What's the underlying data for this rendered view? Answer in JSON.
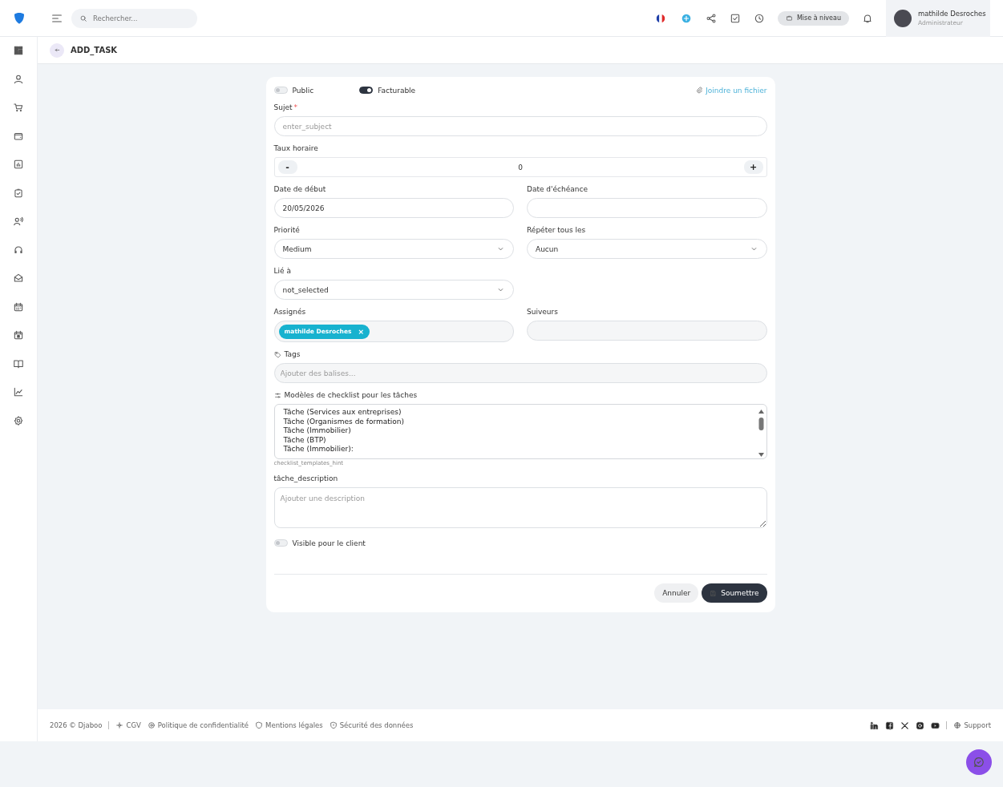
{
  "topbar": {
    "search": {
      "placeholder": "Rechercher..."
    },
    "upgrade_button": "Mise à niveau",
    "user": {
      "name": "mathilde Desroches",
      "role": "Administrateur"
    }
  },
  "page_header": {
    "title": "ADD_TASK"
  },
  "form": {
    "toggles": [
      {
        "label": "Public",
        "on": false
      },
      {
        "label": "Facturable",
        "on": true
      }
    ],
    "attach_link": "Joindre un fichier",
    "subject": {
      "label": "Sujet",
      "required_mark": "*",
      "placeholder": "enter_subject"
    },
    "hourly_rate": {
      "label": "Taux horaire",
      "value": "0",
      "minus": "-",
      "plus": "+"
    },
    "start_date": {
      "label": "Date de début",
      "value": "20/05/2026"
    },
    "due_date": {
      "label": "Date d'échéance"
    },
    "priority": {
      "label": "Priorité",
      "value": "Medium"
    },
    "repeat": {
      "label": "Répéter tous les",
      "value": "Aucun"
    },
    "related_to": {
      "label": "Lié à",
      "value": "not_selected"
    },
    "assignees": {
      "label": "Assignés",
      "chips": [
        {
          "name": "mathilde Desroches",
          "remove": "×"
        }
      ]
    },
    "followers": {
      "label": "Suiveurs"
    },
    "tags": {
      "label": "Tags",
      "placeholder": "Ajouter des balises..."
    },
    "checklist_templates": {
      "label": "Modèles de checklist pour les tâches",
      "options": [
        "Tâche (Services aux entreprises)",
        "Tâche (Organismes de formation)",
        "Tâche (Immobilier)",
        "Tâche (BTP)",
        "Tâche (Immobilier):"
      ],
      "hint": "checklist_templates_hint"
    },
    "description": {
      "label": "tâche_description",
      "placeholder": "Ajouter une description"
    },
    "client_visible": {
      "label": "Visible pour le client",
      "on": false
    },
    "buttons": {
      "cancel": "Annuler",
      "submit": "Soumettre"
    }
  },
  "footer": {
    "copyright": "2026 © Djaboo",
    "links": [
      {
        "label": "CGV"
      },
      {
        "label": "Politique de confidentialité"
      },
      {
        "label": "Mentions légales"
      },
      {
        "label": "Sécurité des données"
      }
    ],
    "support": "Support"
  }
}
